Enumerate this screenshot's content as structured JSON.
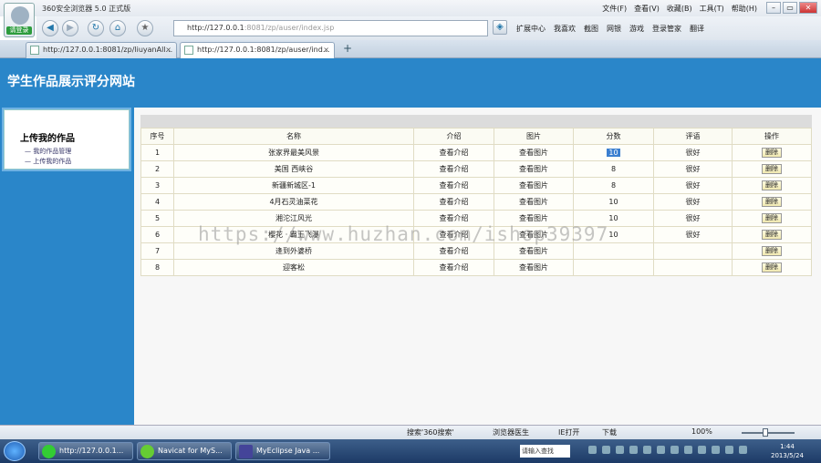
{
  "browser": {
    "logo_label": "请登录",
    "window_title": "360安全浏览器 5.0 正式版",
    "menus": [
      "文件(F)",
      "查看(V)",
      "收藏(B)",
      "工具(T)",
      "帮助(H)"
    ],
    "url_host": "http://127.0.0.1",
    "url_rest": ":8081/zp/auser/index.jsp",
    "toolbar": [
      "扩展中心",
      "我喜欢",
      "截图",
      "网银",
      "游戏",
      "登录管家",
      "翻译"
    ],
    "tabs": [
      {
        "label": "http://127.0.0.1:8081/zp/liuyanAll..."
      },
      {
        "label": "http://127.0.0.1:8081/zp/auser/ind..."
      }
    ],
    "status": {
      "search": "搜索'360搜索'",
      "browser_doctor": "浏览器医生",
      "ie_open": "IE打开",
      "download": "下载",
      "zoom": "100%"
    }
  },
  "site": {
    "title": "学生作品展示评分网站",
    "menu_heading": "上传我的作品",
    "menu_items": [
      "我的作品管理",
      "上传我的作品"
    ]
  },
  "table": {
    "headers": [
      "序号",
      "名称",
      "介绍",
      "图片",
      "分数",
      "评语",
      "操作"
    ],
    "intro_link": "查看介绍",
    "image_link": "查看图片",
    "delete_label": "删除",
    "rows": [
      {
        "no": "1",
        "name": "张家界最美风景",
        "score": "10",
        "comment": "很好"
      },
      {
        "no": "2",
        "name": "美国 西峡谷",
        "score": "8",
        "comment": "很好"
      },
      {
        "no": "3",
        "name": "新疆新城区-1",
        "score": "8",
        "comment": "很好"
      },
      {
        "no": "4",
        "name": "4月石灵油菜花",
        "score": "10",
        "comment": "很好"
      },
      {
        "no": "5",
        "name": "湘沱江风光",
        "score": "10",
        "comment": "很好"
      },
      {
        "no": "6",
        "name": "樱花 · 霸王飞瀑",
        "score": "10",
        "comment": "很好"
      },
      {
        "no": "7",
        "name": "逢到外婆桥",
        "score": "",
        "comment": ""
      },
      {
        "no": "8",
        "name": "迎客松",
        "score": "",
        "comment": ""
      }
    ]
  },
  "watermark": "https://www.huzhan.com/ishop39397",
  "taskbar": {
    "buttons": [
      "http://127.0.0.1...",
      "Navicat for MyS...",
      "MyEclipse Java ..."
    ],
    "ime": "请输入查找",
    "time": "1:44",
    "date": "2013/5/24"
  }
}
